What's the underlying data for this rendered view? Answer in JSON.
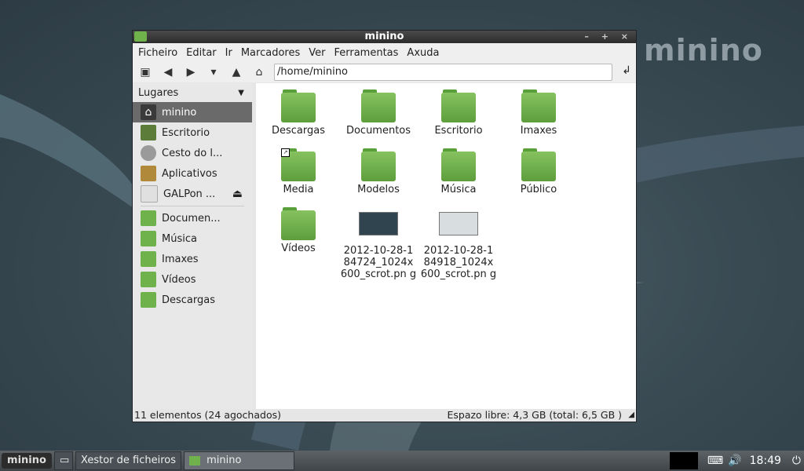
{
  "desktop": {
    "brand": "minino"
  },
  "window": {
    "title": "minino",
    "controls": "– + ×",
    "menu": [
      "Ficheiro",
      "Editar",
      "Ir",
      "Marcadores",
      "Ver",
      "Ferramentas",
      "Axuda"
    ],
    "path": "/home/minino",
    "sidebar": {
      "header": "Lugares",
      "items": [
        {
          "label": "minino",
          "icon": "home-icon",
          "color": "#3a3a3a"
        },
        {
          "label": "Escritorio",
          "icon": "desktop-icon",
          "color": "#5c7c3a"
        },
        {
          "label": "Cesto do l...",
          "icon": "trash-icon",
          "color": "#8a8a8a"
        },
        {
          "label": "Aplicativos",
          "icon": "applications-icon",
          "color": "#b08a3a"
        },
        {
          "label": "GALPon ...",
          "icon": "drive-icon",
          "color": "#9a9a9a"
        }
      ],
      "eject": "⏏",
      "bookmarks": [
        {
          "label": "Documen..."
        },
        {
          "label": "Música"
        },
        {
          "label": "Imaxes"
        },
        {
          "label": "Vídeos"
        },
        {
          "label": "Descargas"
        }
      ]
    },
    "items": [
      {
        "label": "Descargas",
        "type": "folder"
      },
      {
        "label": "Documentos",
        "type": "folder"
      },
      {
        "label": "Escritorio",
        "type": "folder"
      },
      {
        "label": "Imaxes",
        "type": "folder"
      },
      {
        "label": "Media",
        "type": "folder"
      },
      {
        "label": "Modelos",
        "type": "folder"
      },
      {
        "label": "Música",
        "type": "folder"
      },
      {
        "label": "Público",
        "type": "folder"
      },
      {
        "label": "Vídeos",
        "type": "folder"
      },
      {
        "label": "2012-10-28-1 84724_1024x 600_scrot.pn g",
        "type": "image"
      },
      {
        "label": "2012-10-28-1 84918_1024x 600_scrot.pn g",
        "type": "image"
      }
    ],
    "status_left": "11 elementos (24 agochados)",
    "status_right": "Espazo libre: 4,3 GB (total: 6,5 GB )"
  },
  "taskbar": {
    "logo": "minino",
    "tasks": [
      "Xestor de ficheiros",
      "minino"
    ],
    "clock": "18:49"
  }
}
